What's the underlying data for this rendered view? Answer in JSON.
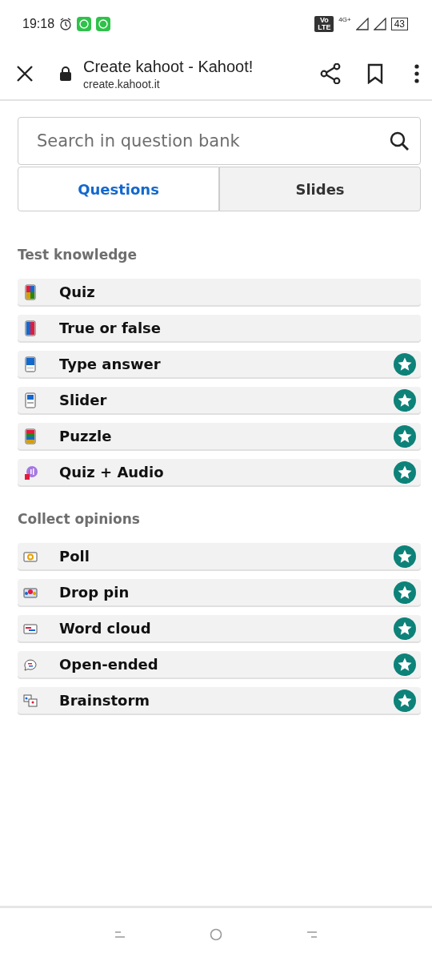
{
  "status_bar": {
    "time": "19:18",
    "network": "4G+",
    "volte": "Vo LTE",
    "battery": "43"
  },
  "browser": {
    "title": "Create kahoot - Kahoot!",
    "url": "create.kahoot.it"
  },
  "search": {
    "placeholder": "Search in question bank"
  },
  "tabs": [
    {
      "label": "Questions",
      "selected": true
    },
    {
      "label": "Slides",
      "selected": false
    }
  ],
  "sections": [
    {
      "title": "Test knowledge",
      "items": [
        {
          "label": "Quiz",
          "kind": "quiz",
          "premium": false
        },
        {
          "label": "True or false",
          "kind": "truefalse",
          "premium": false
        },
        {
          "label": "Type answer",
          "kind": "type",
          "premium": true
        },
        {
          "label": "Slider",
          "kind": "slider",
          "premium": true
        },
        {
          "label": "Puzzle",
          "kind": "puzzle",
          "premium": true
        },
        {
          "label": "Quiz + Audio",
          "kind": "audio",
          "premium": true
        }
      ]
    },
    {
      "title": "Collect opinions",
      "items": [
        {
          "label": "Poll",
          "kind": "poll",
          "premium": true
        },
        {
          "label": "Drop pin",
          "kind": "pin",
          "premium": true
        },
        {
          "label": "Word cloud",
          "kind": "cloud",
          "premium": true
        },
        {
          "label": "Open-ended",
          "kind": "open",
          "premium": true
        },
        {
          "label": "Brainstorm",
          "kind": "brainstorm",
          "premium": true
        }
      ]
    }
  ]
}
